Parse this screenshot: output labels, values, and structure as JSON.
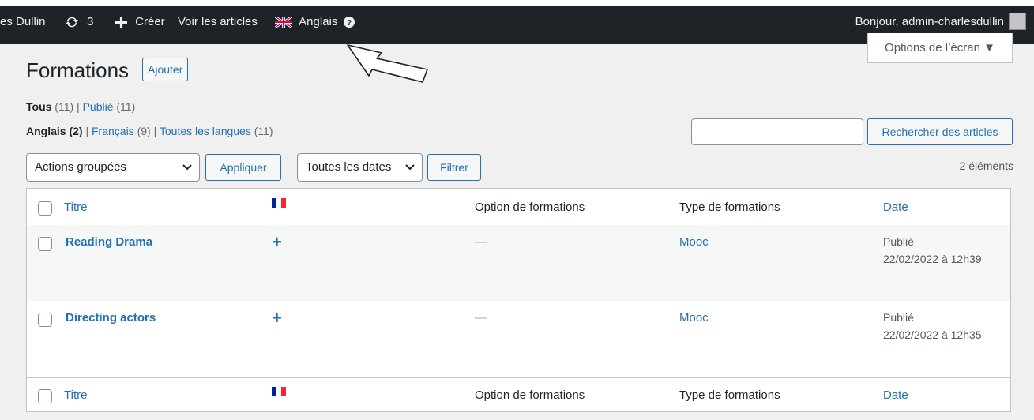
{
  "admin_bar": {
    "site_name": "es Dullin",
    "updates_count": "3",
    "create_label": "Créer",
    "view_posts_label": "Voir les articles",
    "language_label": "Anglais",
    "greeting": "Bonjour, admin-charlesdullin"
  },
  "screen_options": {
    "label": "Options de l’écran ▼"
  },
  "page": {
    "title": "Formations",
    "add_button": "Ajouter"
  },
  "status_filters": {
    "all_label": "Tous",
    "all_count": "(11)",
    "separator": "|",
    "published_label": "Publié",
    "published_count": "(11)"
  },
  "language_filters": {
    "english_label": "Anglais (2)",
    "separator": "|",
    "french_label": "Français",
    "french_count": "(9)",
    "all_label": "Toutes les langues",
    "all_count": "(11)"
  },
  "search": {
    "value": "",
    "button_label": "Rechercher des articles"
  },
  "bulk": {
    "select_value": "Actions groupées",
    "apply_label": "Appliquer"
  },
  "date_filter": {
    "select_value": "Toutes les dates",
    "filter_label": "Filtrer"
  },
  "items_count": "2 éléments",
  "table": {
    "columns": {
      "title": "Titre",
      "option": "Option de formations",
      "type": "Type de formations",
      "date": "Date"
    },
    "rows": [
      {
        "title": "Reading Drama",
        "translation": "+",
        "option": "—",
        "type": "Mooc",
        "status": "Publié",
        "date": "22/02/2022 à 12h39"
      },
      {
        "title": "Directing actors",
        "translation": "+",
        "option": "—",
        "type": "Mooc",
        "status": "Publié",
        "date": "22/02/2022 à 12h35"
      }
    ]
  },
  "colors": {
    "accent": "#2271b1",
    "admin_bar": "#1d2327",
    "background": "#f0f0f1"
  }
}
